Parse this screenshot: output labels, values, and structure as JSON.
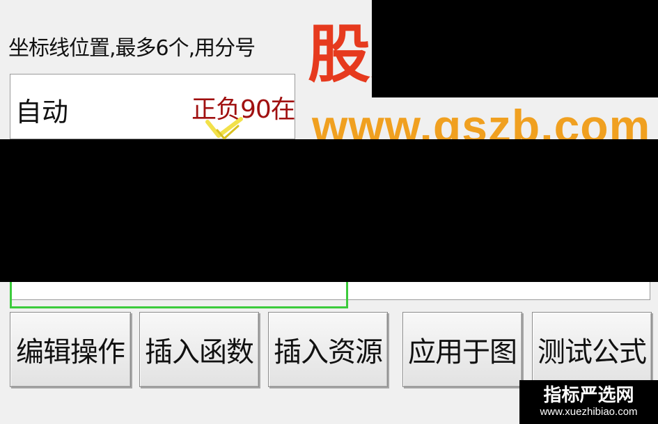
{
  "form": {
    "axis_label": "坐标线位置,最多6个,用分号",
    "axis_value": "自动",
    "annotation": "正负90在"
  },
  "watermark": {
    "site_name": "股票",
    "site_url": "www.gszb.com"
  },
  "buttons": {
    "edit": "编辑操作",
    "insert_function": "插入函数",
    "insert_resource": "插入资源",
    "apply_to_chart": "应用于图",
    "test_formula": "测试公式"
  },
  "badge": {
    "title": "指标严选网",
    "url": "www.xuezhibiao.com"
  },
  "colors": {
    "annotation": "#a01010",
    "watermark_title": "#e63a1e",
    "watermark_url": "#f0a020",
    "highlight_box": "#3ccb3c"
  },
  "icons": [
    "arrow-pointer-icon"
  ]
}
